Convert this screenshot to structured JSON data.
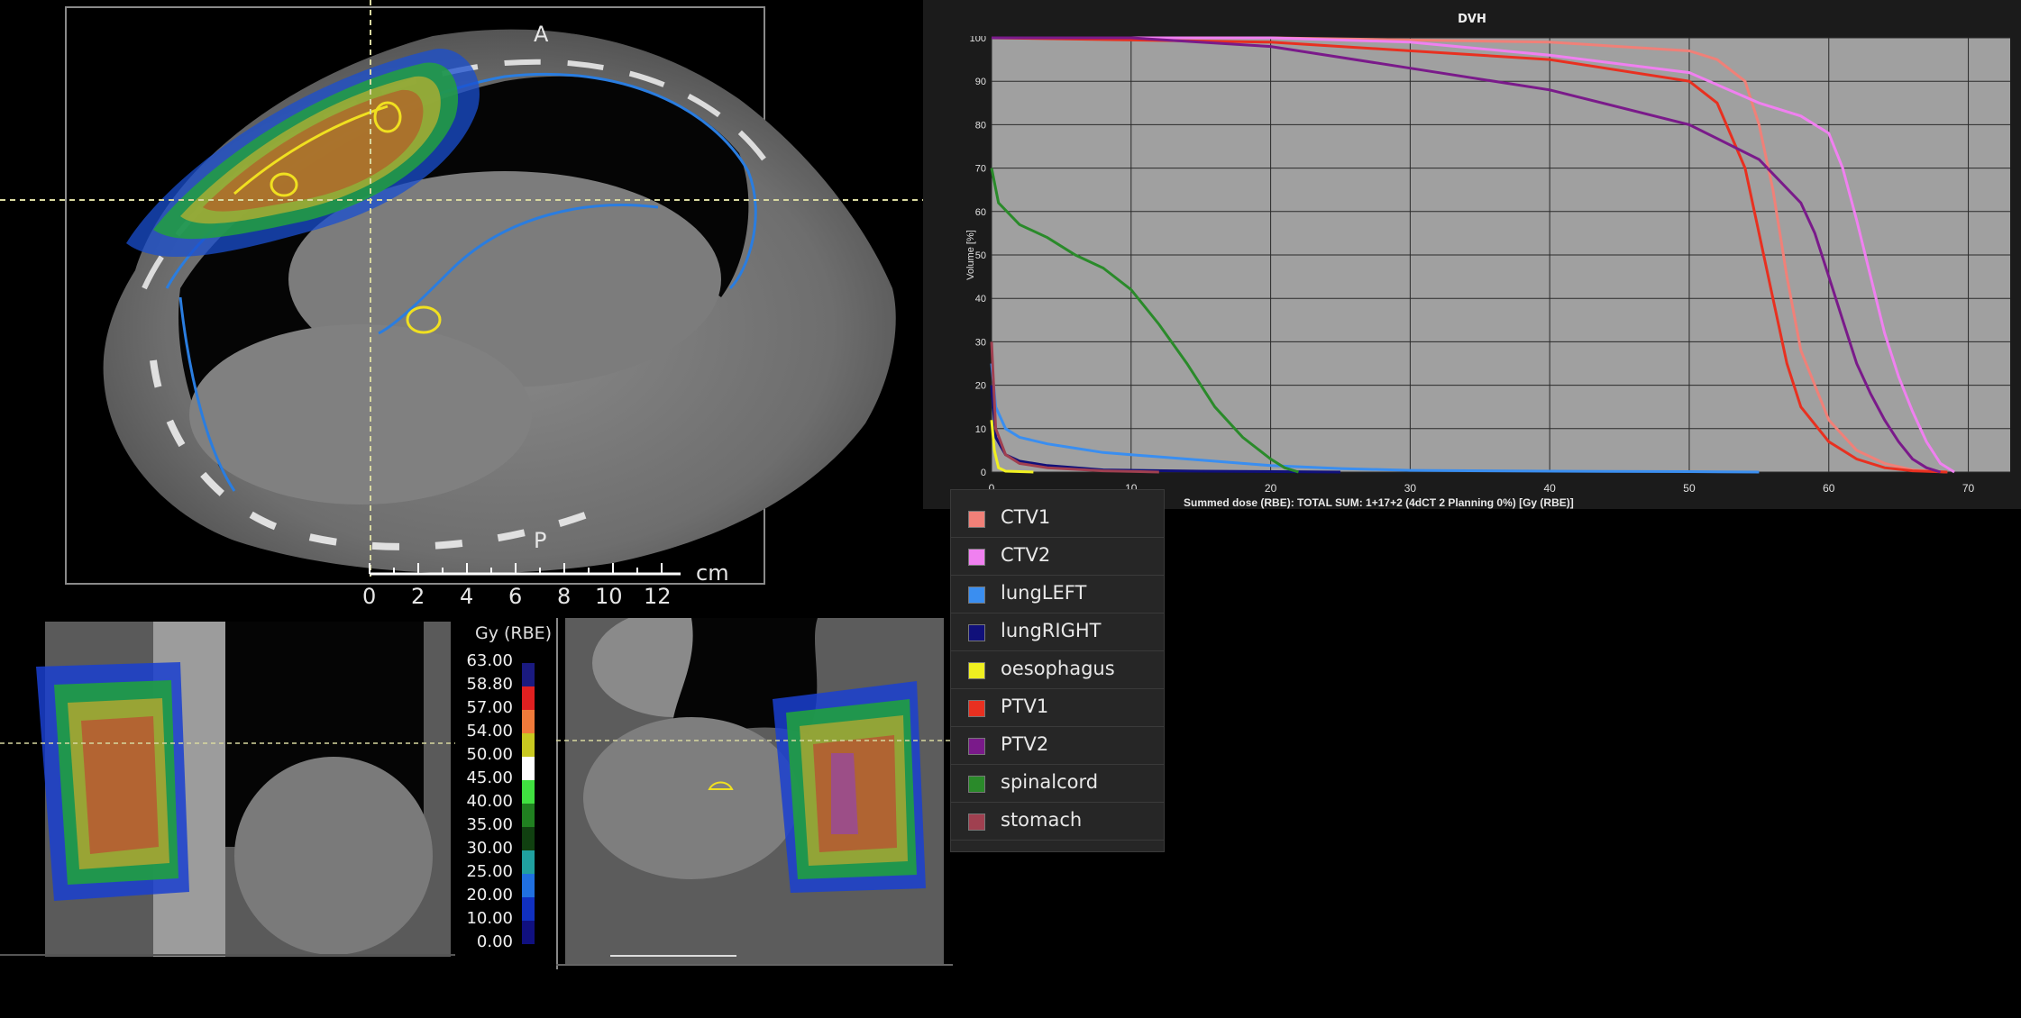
{
  "axial_view": {
    "orientation_top": "A",
    "orientation_bottom": "P",
    "scale_unit": "cm",
    "scale_ticks": [
      "0",
      "2",
      "4",
      "6",
      "8",
      "10",
      "12"
    ]
  },
  "colorbar": {
    "title": "Gy (RBE)",
    "levels": [
      {
        "value": "63.00",
        "color": "#1a1a80"
      },
      {
        "value": "58.80",
        "color": "#e02020"
      },
      {
        "value": "57.00",
        "color": "#f07a3a"
      },
      {
        "value": "54.00",
        "color": "#c8c820"
      },
      {
        "value": "50.00",
        "color": "#ffffff"
      },
      {
        "value": "45.00",
        "color": "#40e040"
      },
      {
        "value": "40.00",
        "color": "#208020"
      },
      {
        "value": "35.00",
        "color": "#104010"
      },
      {
        "value": "30.00",
        "color": "#20a0a0"
      },
      {
        "value": "25.00",
        "color": "#2070e0"
      },
      {
        "value": "20.00",
        "color": "#1030c0"
      },
      {
        "value": "10.00",
        "color": "#101080"
      },
      {
        "value": "0.00",
        "color": "#000000"
      }
    ]
  },
  "dvh": {
    "title": "DVH",
    "xlabel": "Summed dose (RBE): TOTAL SUM: 1+17+2 (4dCT 2 Planning 0%) [Gy (RBE)]",
    "ylabel": "Volume [%]"
  },
  "legend": {
    "items": [
      {
        "label": "CTV1",
        "color": "#f08078"
      },
      {
        "label": "CTV2",
        "color": "#f080f0"
      },
      {
        "label": "lungLEFT",
        "color": "#3a8ef0"
      },
      {
        "label": "lungRIGHT",
        "color": "#10107a"
      },
      {
        "label": "oesophagus",
        "color": "#f0f020"
      },
      {
        "label": "PTV1",
        "color": "#e83020"
      },
      {
        "label": "PTV2",
        "color": "#7a1a8a"
      },
      {
        "label": "spinalcord",
        "color": "#2a8a2a"
      },
      {
        "label": "stomach",
        "color": "#a04050"
      }
    ]
  },
  "chart_data": {
    "type": "line",
    "title": "DVH",
    "xlabel": "Summed dose (RBE): TOTAL SUM: 1+17+2 (4dCT 2 Planning 0%) [Gy (RBE)]",
    "ylabel": "Volume [%]",
    "xlim": [
      0,
      73
    ],
    "ylim": [
      0,
      100
    ],
    "xticks": [
      0,
      10,
      20,
      30,
      40,
      50,
      60,
      70
    ],
    "yticks": [
      0,
      10,
      20,
      30,
      40,
      50,
      60,
      70,
      80,
      90,
      100
    ],
    "grid": true,
    "series": [
      {
        "name": "CTV1",
        "color": "#f08078",
        "x": [
          0,
          20,
          40,
          50,
          52,
          54,
          55,
          56,
          57,
          58,
          60,
          62,
          64,
          66,
          68.5
        ],
        "y": [
          100,
          100,
          99,
          97,
          95,
          90,
          80,
          65,
          45,
          28,
          12,
          5,
          2,
          0.5,
          0
        ]
      },
      {
        "name": "CTV2",
        "color": "#f080f0",
        "x": [
          0,
          20,
          30,
          40,
          50,
          55,
          58,
          60,
          61,
          62,
          63,
          64,
          65,
          66,
          67,
          68,
          69
        ],
        "y": [
          100,
          100,
          99,
          96,
          92,
          85,
          82,
          78,
          70,
          58,
          45,
          32,
          22,
          14,
          7,
          2,
          0
        ]
      },
      {
        "name": "lungLEFT",
        "color": "#3a8ef0",
        "x": [
          0,
          0.3,
          1,
          2,
          4,
          6,
          8,
          10,
          14,
          20,
          25,
          30,
          40,
          50,
          55
        ],
        "y": [
          25,
          15,
          10,
          8,
          6.5,
          5.5,
          4.5,
          4,
          3,
          1.5,
          0.8,
          0.4,
          0.2,
          0.1,
          0
        ]
      },
      {
        "name": "lungRIGHT",
        "color": "#10107a",
        "x": [
          0,
          0.3,
          1,
          2,
          4,
          8,
          15,
          25
        ],
        "y": [
          20,
          8,
          4,
          2.5,
          1.5,
          0.5,
          0.2,
          0
        ]
      },
      {
        "name": "oesophagus",
        "color": "#f0f020",
        "x": [
          0,
          0.2,
          0.5,
          1,
          3
        ],
        "y": [
          12,
          5,
          1,
          0.2,
          0
        ]
      },
      {
        "name": "PTV1",
        "color": "#e83020",
        "x": [
          0,
          20,
          40,
          50,
          52,
          54,
          55,
          56,
          57,
          58,
          60,
          62,
          64,
          66,
          68.5
        ],
        "y": [
          100,
          99,
          95,
          90,
          85,
          70,
          55,
          40,
          25,
          15,
          7,
          3,
          1,
          0.3,
          0
        ]
      },
      {
        "name": "PTV2",
        "color": "#7a1a8a",
        "x": [
          0,
          10,
          20,
          30,
          40,
          50,
          55,
          58,
          59,
          60,
          61,
          62,
          63,
          64,
          65,
          66,
          67,
          68
        ],
        "y": [
          100,
          100,
          98,
          93,
          88,
          80,
          72,
          62,
          55,
          45,
          35,
          25,
          18,
          12,
          7,
          3,
          1,
          0
        ]
      },
      {
        "name": "spinalcord",
        "color": "#2a8a2a",
        "x": [
          0,
          0.5,
          2,
          4,
          6,
          8,
          10,
          12,
          14,
          16,
          18,
          20,
          21,
          22
        ],
        "y": [
          70,
          62,
          57,
          54,
          50,
          47,
          42,
          34,
          25,
          15,
          8,
          3,
          1,
          0
        ]
      },
      {
        "name": "stomach",
        "color": "#a04050",
        "x": [
          0,
          0.3,
          1,
          2,
          4,
          8,
          12
        ],
        "y": [
          30,
          10,
          4,
          2,
          1,
          0.3,
          0
        ]
      }
    ]
  }
}
